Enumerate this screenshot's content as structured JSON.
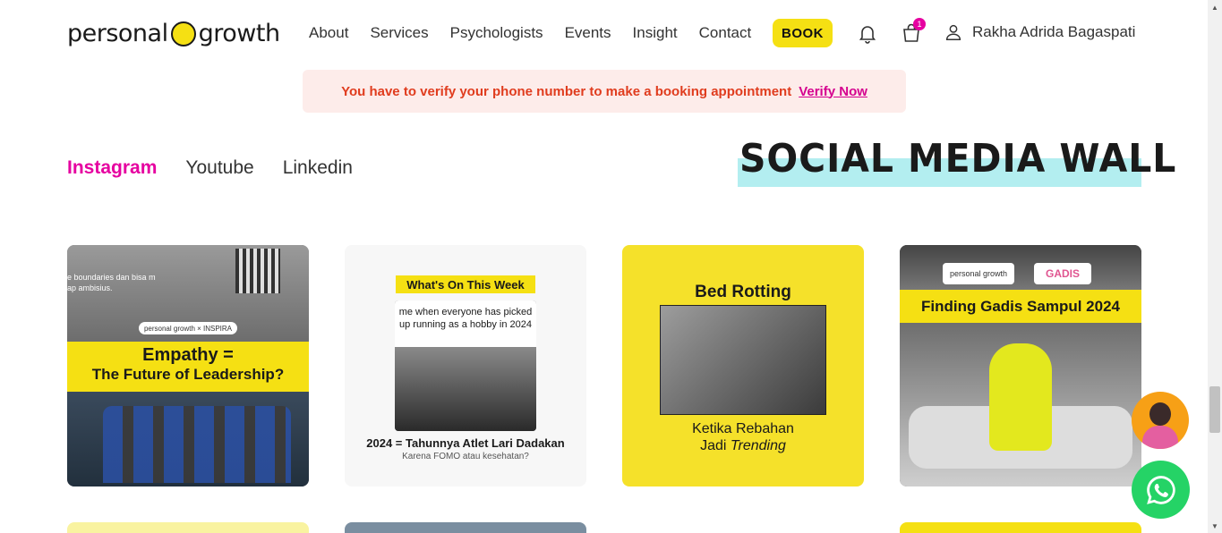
{
  "header": {
    "logo_left": "personal",
    "logo_right": "growth",
    "nav": [
      "About",
      "Services",
      "Psychologists",
      "Events",
      "Insight",
      "Contact"
    ],
    "book_label": "BOOK",
    "cart_count": "1",
    "user_name": "Rakha Adrida Bagaspati"
  },
  "alert": {
    "message": "You have to verify your phone number to make a booking appointment",
    "link": "Verify Now"
  },
  "tabs": [
    "Instagram",
    "Youtube",
    "Linkedin"
  ],
  "section_title": "SOCIAL MEDIA WALL",
  "cards": [
    {
      "side_text": "e boundaries dan bisa m ap ambisius.",
      "logo_pill": "personal growth  ×  INSPIRA",
      "line1": "Empathy =",
      "line2": "The Future of Leadership?"
    },
    {
      "header": "What's On This Week",
      "meme": "me when everyone has picked up running as a hobby in 2024",
      "caption": "2024 = Tahunnya Atlet Lari Dadakan",
      "subcaption": "Karena FOMO atau kesehatan?"
    },
    {
      "title": "Bed Rotting",
      "caption_line1": "Ketika Rebahan",
      "caption_line2_prefix": "Jadi ",
      "caption_line2_italic": "Trending"
    },
    {
      "pill1": "personal growth",
      "pill2": "GADIS",
      "band": "Finding Gadis Sampul 2024"
    }
  ],
  "colors": {
    "accent_pink": "#e600a0",
    "brand_yellow": "#f5e013",
    "title_highlight": "#b3eef0",
    "alert_bg": "#fdecea",
    "alert_text": "#e03c1e",
    "whatsapp_green": "#25d366"
  },
  "icons": {
    "bell": "bell-icon",
    "cart": "shopping-bag-icon",
    "user": "user-icon",
    "whatsapp": "whatsapp-icon",
    "agent": "customer-service-icon"
  }
}
